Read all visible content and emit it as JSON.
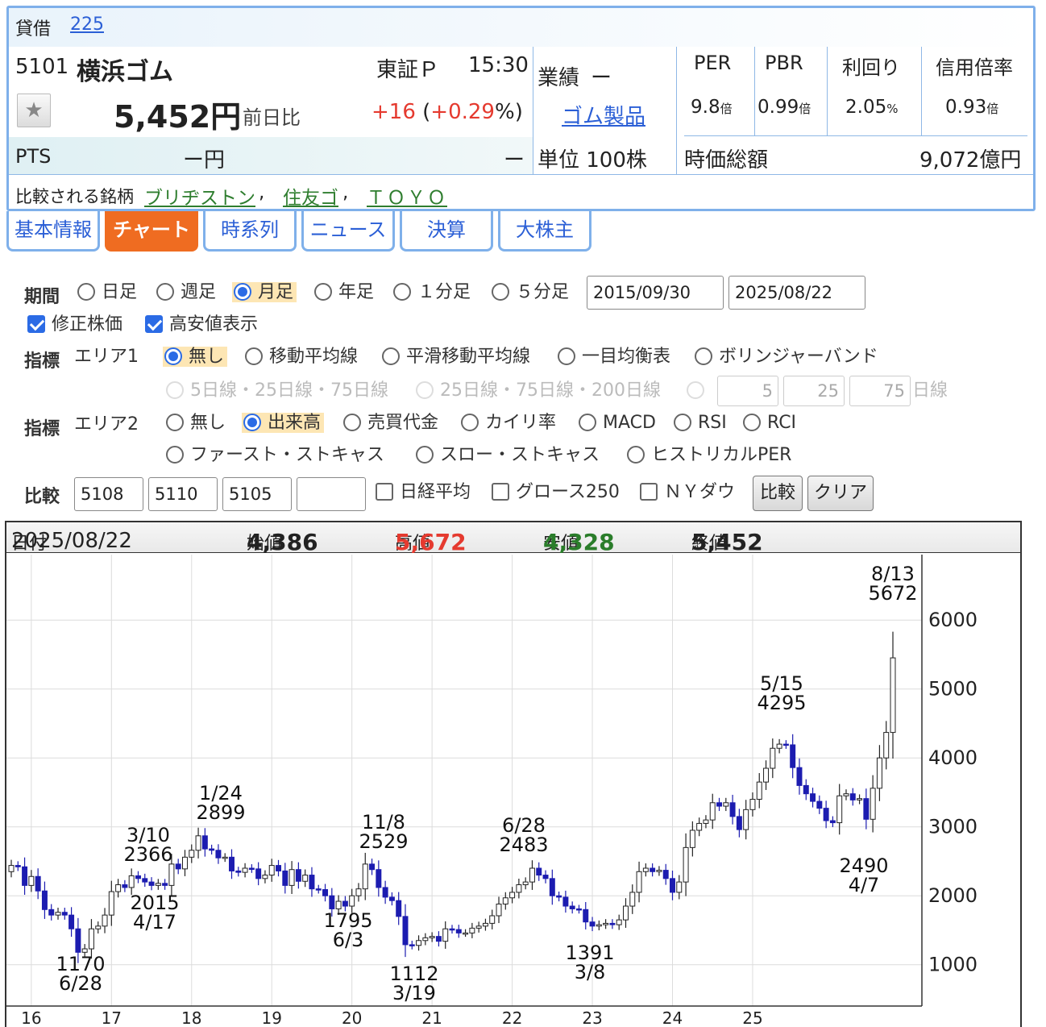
{
  "header": {
    "margin_label": "貸借",
    "index_link": "225",
    "code": "5101",
    "name": "横浜ゴム",
    "market": "東証Ｐ",
    "time": "15:30",
    "price": "5,452円",
    "change_label": "前日比",
    "change": "+16",
    "change_pct_open": "(",
    "change_pct": "+0.29",
    "change_pct_close": "%)",
    "pts_label": "PTS",
    "pts_price": "ー円",
    "pts_change": "ー",
    "earnings_label": "業績",
    "earnings_value": "ー",
    "sector_link": "ゴム製品",
    "unit": "単位 100株",
    "metrics": [
      {
        "label": "PER",
        "value": "9.8",
        "unit": "倍"
      },
      {
        "label": "PBR",
        "value": "0.99",
        "unit": "倍"
      },
      {
        "label": "利回り",
        "value": "2.05",
        "unit": "%"
      },
      {
        "label": "信用倍率",
        "value": "0.93",
        "unit": "倍"
      }
    ],
    "market_cap_label": "時価総額",
    "market_cap_value": "9,072億円",
    "compare_label": "比較される銘柄",
    "compare_links": [
      "ブリヂストン",
      "住友ゴ",
      "ＴＯＹＯ"
    ],
    "sep": ","
  },
  "tabs": [
    "基本情報",
    "チャート",
    "時系列",
    "ニュース",
    "決算",
    "大株主"
  ],
  "options": {
    "period_label": "期間",
    "period": [
      "日足",
      "週足",
      "月足",
      "年足",
      "１分足",
      "５分足"
    ],
    "date_from": "2015/09/30",
    "date_to": "2025/08/22",
    "adjusted": "修正株価",
    "highlow": "高安値表示",
    "indicator_label": "指標",
    "area1_label": "エリア1",
    "area1": [
      "無し",
      "移動平均線",
      "平滑移動平均線",
      "一目均衡表",
      "ボリンジャーバンド"
    ],
    "ma_sets": [
      "5日線・25日線・75日線",
      "25日線・75日線・200日線"
    ],
    "ma_inputs": [
      "5",
      "25",
      "75"
    ],
    "ma_suffix": "日線",
    "area2_label": "エリア2",
    "area2": [
      "無し",
      "出来高",
      "売買代金",
      "カイリ率",
      "MACD",
      "RSI",
      "RCI",
      "ファースト・ストキャス",
      "スロー・ストキャス",
      "ヒストリカルPER"
    ],
    "compare_label": "比較",
    "compare_codes": [
      "5108",
      "5110",
      "5105",
      ""
    ],
    "compare_checks": [
      "日経平均",
      "グロース250",
      "ＮＹダウ"
    ],
    "compare_button": "比較",
    "clear_button": "クリア"
  },
  "chart_info": {
    "date_label": "日付",
    "date": "2025/08/22",
    "open_label": "始値",
    "open": "4,386",
    "high_label": "高値",
    "high": "5,672",
    "low_label": "安値",
    "low": "4,328",
    "close_label": "終値",
    "close": "5,452"
  },
  "colors": {
    "up": "#ffffff",
    "down": "#1c1cb0",
    "accent": "#ef6c21",
    "high": "#e53a2f",
    "low": "#2a7d2a"
  },
  "chart_data": {
    "type": "candlestick",
    "interval": "monthly",
    "x_ticks": [
      "16",
      "17",
      "18",
      "19",
      "20",
      "21",
      "22",
      "23",
      "24",
      "25"
    ],
    "y_ticks": [
      1000,
      2000,
      3000,
      4000,
      5000,
      6000
    ],
    "ylim": [
      400,
      6950
    ],
    "closes_approx": [
      2440,
      2420,
      2150,
      2280,
      2070,
      1800,
      1720,
      1760,
      1720,
      1520,
      1180,
      1230,
      1520,
      1560,
      1720,
      2060,
      2160,
      2120,
      2290,
      2250,
      2200,
      2150,
      2180,
      2150,
      2460,
      2390,
      2560,
      2660,
      2870,
      2680,
      2660,
      2550,
      2560,
      2360,
      2340,
      2400,
      2390,
      2250,
      2300,
      2440,
      2360,
      2150,
      2380,
      2210,
      2300,
      2100,
      2090,
      2000,
      1810,
      1920,
      1850,
      2000,
      2100,
      2460,
      2380,
      2120,
      1980,
      1930,
      1700,
      1290,
      1280,
      1350,
      1390,
      1410,
      1340,
      1520,
      1510,
      1460,
      1460,
      1530,
      1560,
      1600,
      1710,
      1880,
      1970,
      2050,
      2160,
      2200,
      2400,
      2300,
      2250,
      2000,
      1980,
      1850,
      1810,
      1800,
      1620,
      1560,
      1580,
      1600,
      1580,
      1650,
      1850,
      2050,
      2350,
      2400,
      2350,
      2370,
      2250,
      2050,
      2200,
      2700,
      2950,
      3050,
      3100,
      3350,
      3300,
      3350,
      3150,
      2960,
      3250,
      3400,
      3650,
      3850,
      4140,
      4200,
      4190,
      3860,
      3600,
      3480,
      3370,
      3270,
      3090,
      3060,
      3450,
      3480,
      3390,
      3410,
      3110,
      3560,
      4000,
      4370,
      5452
    ],
    "annotations": [
      {
        "label": "1170",
        "date": "6/28"
      },
      {
        "label": "3/10",
        "value": "2366"
      },
      {
        "label": "2015",
        "date": "4/17"
      },
      {
        "label": "1/24",
        "value": "2899"
      },
      {
        "label": "1795",
        "date": "6/3"
      },
      {
        "label": "11/8",
        "value": "2529"
      },
      {
        "label": "1112",
        "date": "3/19"
      },
      {
        "label": "6/28",
        "value": "2483"
      },
      {
        "label": "1391",
        "date": "3/8"
      },
      {
        "label": "5/15",
        "value": "4295"
      },
      {
        "label": "2490",
        "date": "4/7"
      },
      {
        "label": "8/13",
        "value": "5672"
      }
    ]
  }
}
